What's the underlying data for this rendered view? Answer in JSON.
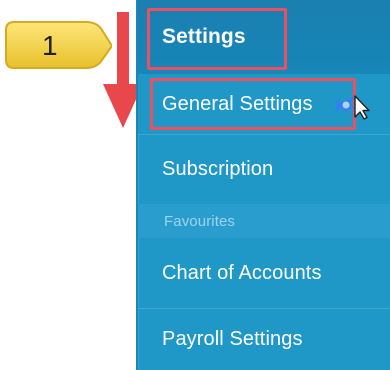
{
  "annotation": {
    "step_number": "1"
  },
  "menu": {
    "items": [
      {
        "label": "Settings"
      },
      {
        "label": "General Settings"
      },
      {
        "label": "Subscription"
      },
      {
        "label": "Favourites"
      },
      {
        "label": "Chart of Accounts"
      },
      {
        "label": "Payroll Settings"
      }
    ]
  },
  "colors": {
    "menu_bg": "#1f98c8",
    "menu_header_bg": "#1786b8",
    "highlight_red": "#ea4f63",
    "arrow_red": "#e8474c",
    "callout_yellow": "#f6d84b"
  },
  "icons": {
    "callout": "step-callout-icon",
    "arrow": "down-arrow-icon",
    "cursor": "mouse-cursor-icon",
    "spark": "click-spark-icon"
  }
}
